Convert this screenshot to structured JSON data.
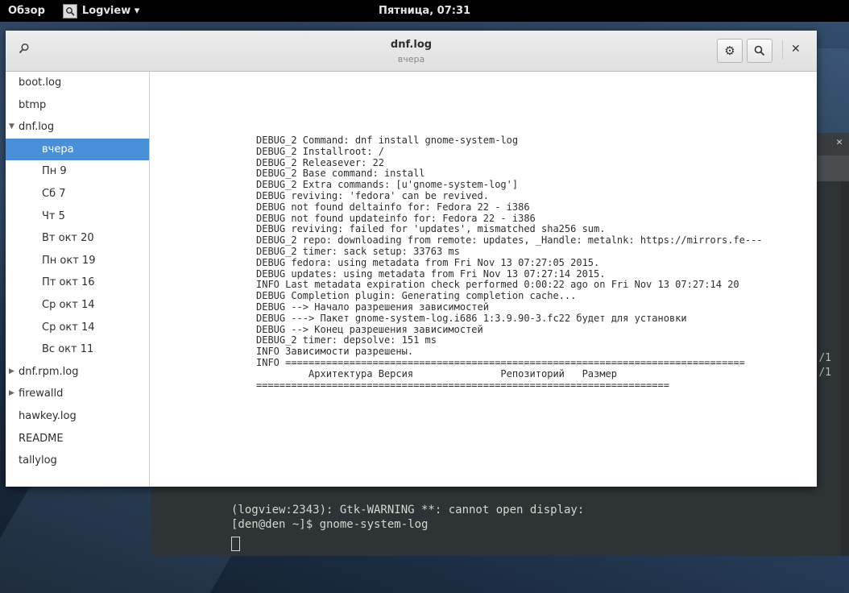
{
  "topbar": {
    "activities": "Обзор",
    "app_name": "Logview ▾",
    "clock": "Пятница, 07:31"
  },
  "terminal": {
    "lines": [
      "(logview:2343): Gtk-WARNING **: cannot open display:",
      "[den@den ~]$ gnome-system-log"
    ],
    "edge_fragments": [
      "/1",
      "/1"
    ]
  },
  "window": {
    "title": "dnf.log",
    "subtitle": "вчера",
    "icons": {
      "search_toggle": "search-icon",
      "settings": "gear-icon",
      "find": "magnifier-icon",
      "close": "close-icon"
    }
  },
  "sidebar": {
    "items": [
      {
        "label": "boot.log",
        "level": 0
      },
      {
        "label": "btmp",
        "level": 0
      },
      {
        "label": "dnf.log",
        "level": 0,
        "expander": "expanded"
      },
      {
        "label": "вчера",
        "level": 1,
        "selected": true
      },
      {
        "label": "Пн 9",
        "level": 1
      },
      {
        "label": "Сб 7",
        "level": 1
      },
      {
        "label": "Чт 5",
        "level": 1
      },
      {
        "label": "Вт окт 20",
        "level": 1
      },
      {
        "label": "Пн окт 19",
        "level": 1
      },
      {
        "label": "Пт окт 16",
        "level": 1
      },
      {
        "label": "Ср окт 14",
        "level": 1
      },
      {
        "label": "Ср окт 14",
        "level": 1
      },
      {
        "label": "Вс окт 11",
        "level": 1
      },
      {
        "label": "dnf.rpm.log",
        "level": 0,
        "expander": "collapsed"
      },
      {
        "label": "firewalld",
        "level": 0,
        "expander": "collapsed"
      },
      {
        "label": "hawkey.log",
        "level": 0
      },
      {
        "label": "README",
        "level": 0
      },
      {
        "label": "tallylog",
        "level": 0
      }
    ]
  },
  "log": {
    "lines": [
      "DEBUG_2 Command: dnf install gnome-system-log",
      "DEBUG_2 Installroot: /",
      "DEBUG_2 Releasever: 22",
      "DEBUG_2 Base command: install",
      "DEBUG_2 Extra commands: [u'gnome-system-log']",
      "DEBUG reviving: 'fedora' can be revived.",
      "DEBUG not found deltainfo for: Fedora 22 - i386",
      "DEBUG not found updateinfo for: Fedora 22 - i386",
      "DEBUG reviving: failed for 'updates', mismatched sha256 sum.",
      "DEBUG_2 repo: downloading from remote: updates, _Handle: metalnk: https://mirrors.fe---",
      "DEBUG_2 timer: sack setup: 33763 ms",
      "DEBUG fedora: using metadata from Fri Nov 13 07:27:05 2015.",
      "DEBUG updates: using metadata from Fri Nov 13 07:27:14 2015.",
      "INFO Last metadata expiration check performed 0:00:22 ago on Fri Nov 13 07:27:14 20",
      "DEBUG Completion plugin: Generating completion cache...",
      "DEBUG --> Начало разрешения зависимостей",
      "DEBUG ---> Пакет gnome-system-log.i686 1:3.9.90-3.fc22 будет для установки",
      "DEBUG --> Конец разрешения зависимостей",
      "DEBUG_2 timer: depsolve: 151 ms",
      "INFO Зависимости разрешены.",
      "INFO ===============================================================================",
      "         Архитектура Версия               Репозиторий   Размер",
      "======================================================================="
    ]
  }
}
